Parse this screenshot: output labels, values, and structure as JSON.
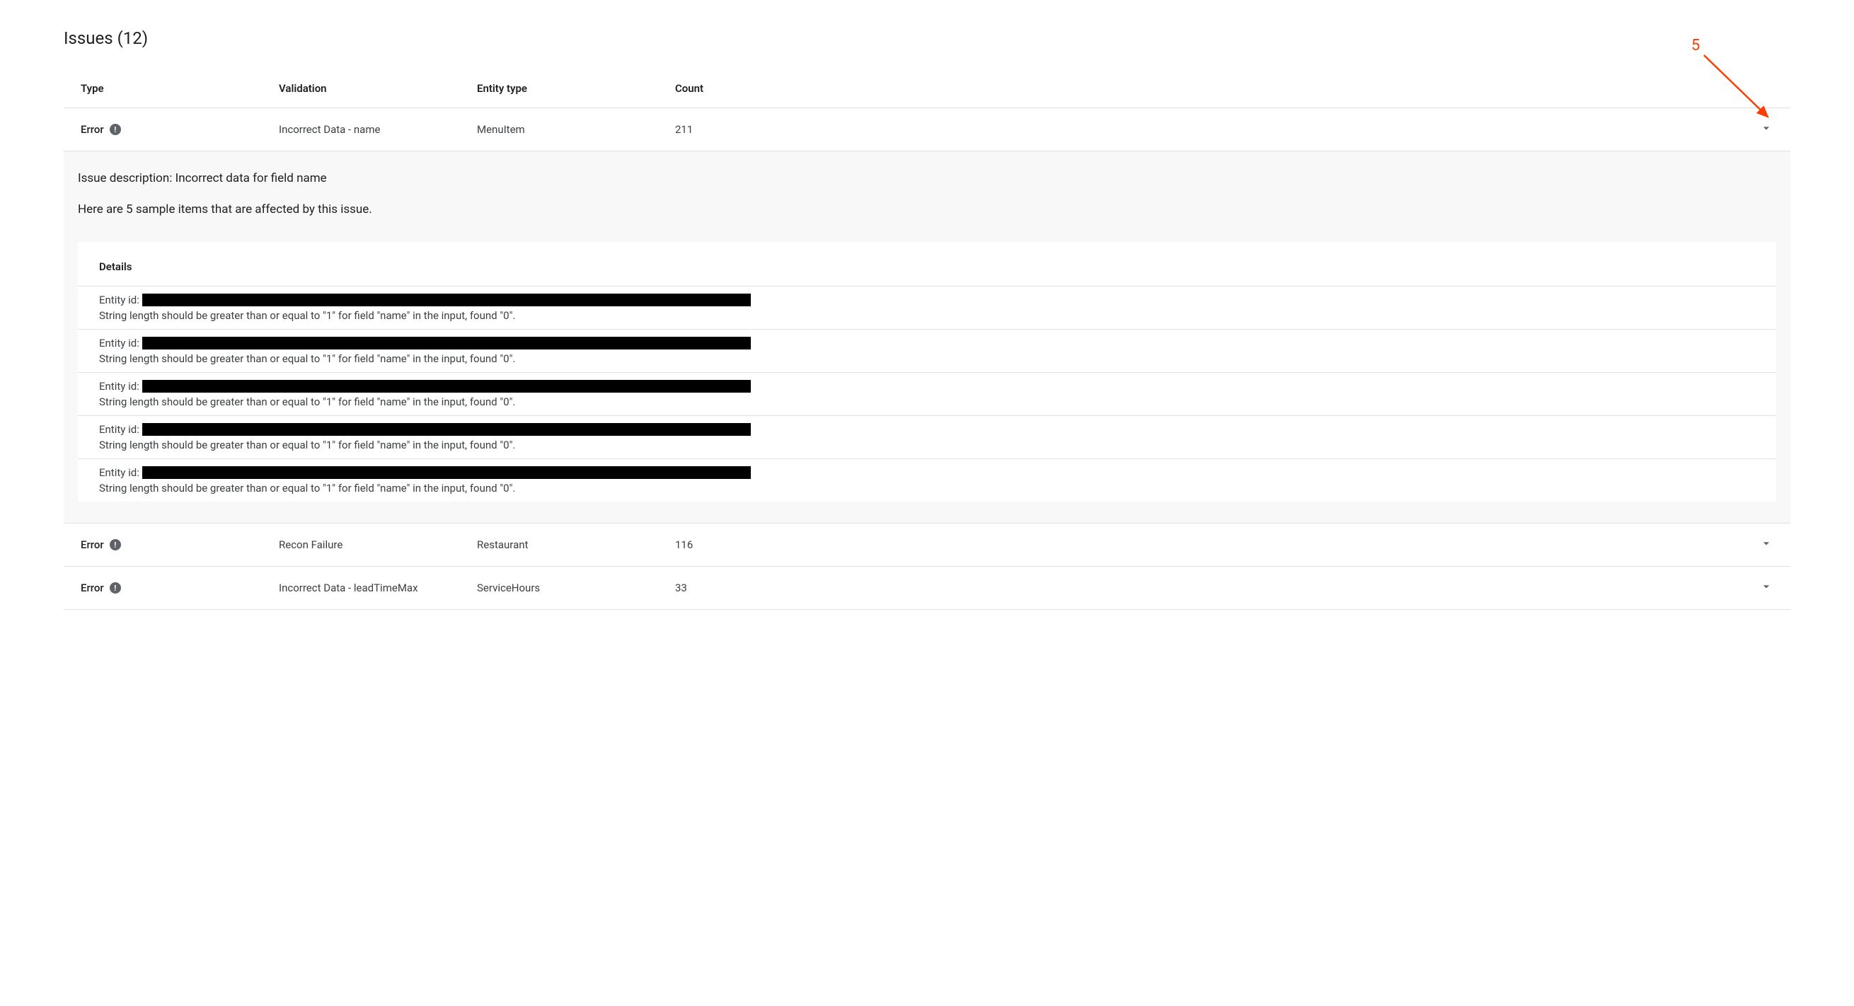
{
  "pageTitle": "Issues (12)",
  "columns": {
    "type": "Type",
    "validation": "Validation",
    "entityType": "Entity type",
    "count": "Count"
  },
  "rows": [
    {
      "type": "Error",
      "validation": "Incorrect Data - name",
      "entityType": "MenuItem",
      "count": "211",
      "expanded": {
        "description": "Issue description: Incorrect data for field name",
        "sampleText": "Here are 5 sample items that are affected by this issue.",
        "detailsHeading": "Details",
        "items": [
          {
            "entityLabel": "Entity id:",
            "message": "String length should be greater than or equal to \"1\" for field \"name\" in the input, found \"0\"."
          },
          {
            "entityLabel": "Entity id:",
            "message": "String length should be greater than or equal to \"1\" for field \"name\" in the input, found \"0\"."
          },
          {
            "entityLabel": "Entity id:",
            "message": "String length should be greater than or equal to \"1\" for field \"name\" in the input, found \"0\"."
          },
          {
            "entityLabel": "Entity id:",
            "message": "String length should be greater than or equal to \"1\" for field \"name\" in the input, found \"0\"."
          },
          {
            "entityLabel": "Entity id:",
            "message": "String length should be greater than or equal to \"1\" for field \"name\" in the input, found \"0\"."
          }
        ]
      }
    },
    {
      "type": "Error",
      "validation": "Recon Failure",
      "entityType": "Restaurant",
      "count": "116"
    },
    {
      "type": "Error",
      "validation": "Incorrect Data - leadTimeMax",
      "entityType": "ServiceHours",
      "count": "33"
    }
  ],
  "annotation": {
    "label": "5"
  }
}
